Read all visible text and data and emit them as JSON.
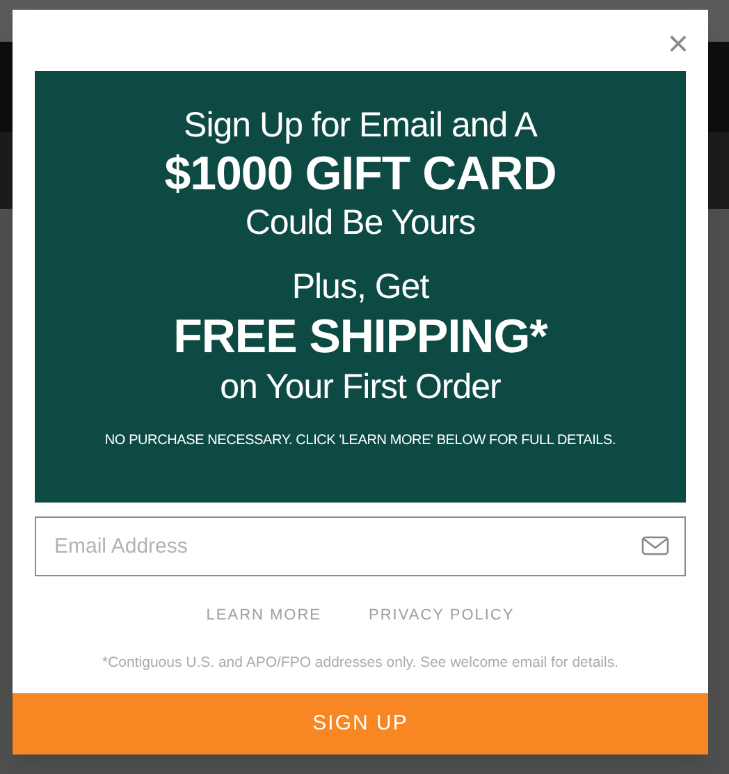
{
  "modal": {
    "close": "×",
    "promo": {
      "line_1": "Sign Up for Email and A",
      "line_2": "$1000 GIFT CARD",
      "line_3": "Could Be Yours",
      "line_4": "Plus, Get",
      "line_5": "FREE SHIPPING*",
      "line_6": "on Your First Order",
      "disclaimer": "NO PURCHASE NECESSARY. CLICK 'LEARN MORE' BELOW FOR FULL DETAILS."
    },
    "email_field": {
      "placeholder": "Email Address"
    },
    "links": [
      "LEARN MORE",
      "PRIVACY POLICY"
    ],
    "footnote": "*Contiguous U.S. and APO/FPO addresses only. See welcome email for details.",
    "submit_button": "SIGN UP"
  }
}
